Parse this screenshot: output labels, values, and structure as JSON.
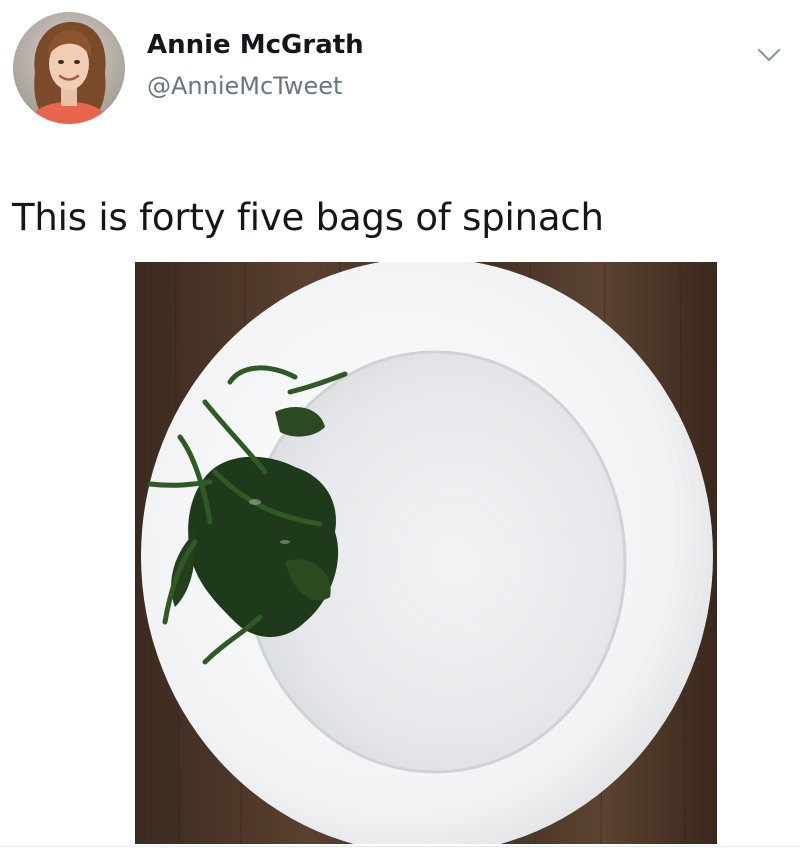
{
  "user": {
    "display_name": "Annie McGrath",
    "handle": "@AnnieMcTweet",
    "avatar_icon": "profile-photo",
    "menu_icon": "chevron-down-icon"
  },
  "tweet": {
    "text": "This is forty five bags of spinach"
  },
  "media": {
    "icon": "photo-plate-of-spinach"
  },
  "colors": {
    "name": "#14171a",
    "handle": "#657786",
    "wood": "#4a3527",
    "plate": "#f3f4f6",
    "spinach": "#1f3a1a"
  }
}
